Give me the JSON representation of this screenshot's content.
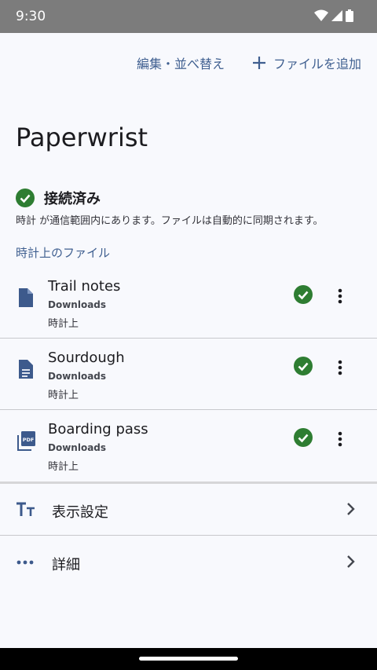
{
  "status_bar": {
    "time": "9:30"
  },
  "top_actions": {
    "edit_sort": "編集・並べ替え",
    "add_file": "ファイルを追加"
  },
  "app_title": "Paperwrist",
  "connection": {
    "label": "接続済み",
    "description": "時計 が通信範囲内にあります。ファイルは自動的に同期されます。"
  },
  "files_section_title": "時計上のファイル",
  "files": [
    {
      "name": "Trail notes",
      "folder": "Downloads",
      "location": "時計上",
      "icon": "file-icon"
    },
    {
      "name": "Sourdough",
      "folder": "Downloads",
      "location": "時計上",
      "icon": "document-icon"
    },
    {
      "name": "Boarding pass",
      "folder": "Downloads",
      "location": "時計上",
      "icon": "pdf-icon"
    }
  ],
  "menu": [
    {
      "label": "表示設定",
      "icon": "text-size-icon"
    },
    {
      "label": "詳細",
      "icon": "more-horiz-icon"
    }
  ],
  "colors": {
    "accent": "#3f5f90",
    "success": "#2e7d32",
    "icon_blue": "#3d5a8c"
  }
}
